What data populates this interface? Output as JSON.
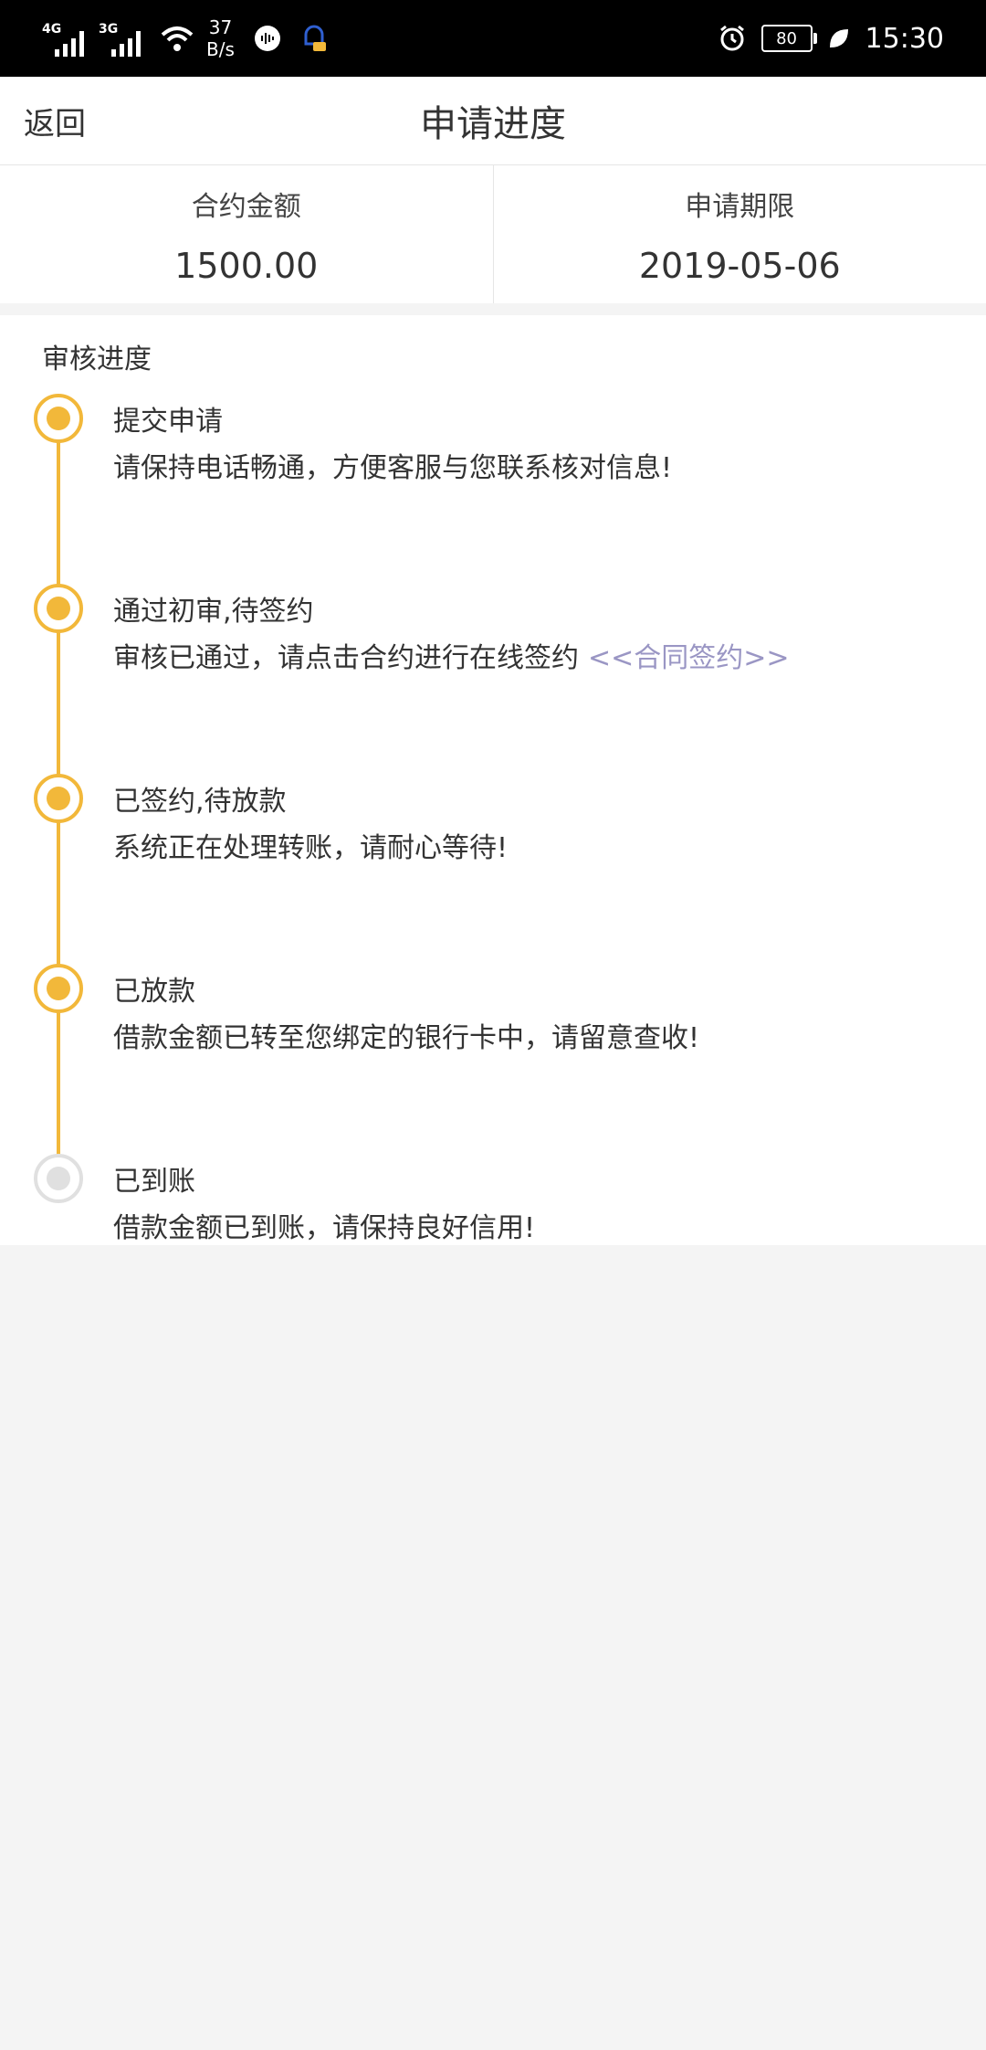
{
  "status_bar": {
    "net1": "4G",
    "net2": "3G",
    "speed_value": "37",
    "speed_unit": "B/s",
    "battery": "80",
    "time": "15:30"
  },
  "header": {
    "back_label": "返回",
    "title": "申请进度"
  },
  "summary": {
    "amount_label": "合约金额",
    "amount_value": "1500.00",
    "date_label": "申请期限",
    "date_value": "2019-05-06"
  },
  "progress": {
    "section_title": "审核进度",
    "steps": [
      {
        "title": "提交申请",
        "desc": "请保持电话畅通，方便客服与您联系核对信息!",
        "state": "done"
      },
      {
        "title": "通过初审,待签约",
        "desc": "审核已通过，请点击合约进行在线签约",
        "link": "<<合同签约>>",
        "state": "done"
      },
      {
        "title": "已签约,待放款",
        "desc": "系统正在处理转账，请耐心等待!",
        "state": "done"
      },
      {
        "title": "已放款",
        "desc": "借款金额已转至您绑定的银行卡中，请留意查收!",
        "state": "done"
      },
      {
        "title": "已到账",
        "desc": "借款金额已到账，请保持良好信用!",
        "state": "pending"
      }
    ]
  },
  "colors": {
    "accent": "#f2b83a",
    "pending": "#e0e0e0",
    "link": "#9a96c4"
  }
}
